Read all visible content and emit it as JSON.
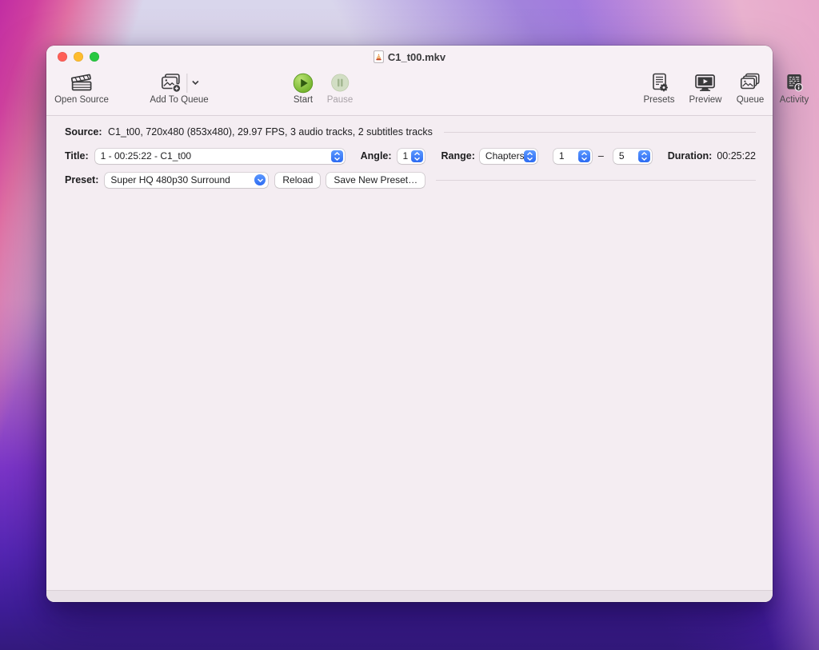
{
  "colors": {
    "accent_blue": "#2d6bf2",
    "accent_blue_light": "#5b98ff",
    "traffic_red": "#ff5f57",
    "traffic_yellow": "#febc2e",
    "traffic_green": "#28c840",
    "start_green": "#6aad24",
    "icon_gray": "#3a3a3c"
  },
  "window": {
    "title": "C1_t00.mkv"
  },
  "toolbar": {
    "open_source": "Open Source",
    "add_to_queue": "Add To Queue",
    "start": "Start",
    "pause": "Pause",
    "presets": "Presets",
    "preview": "Preview",
    "queue": "Queue",
    "activity": "Activity"
  },
  "source": {
    "label": "Source:",
    "value": "C1_t00, 720x480 (853x480), 29.97 FPS, 3 audio tracks, 2 subtitles tracks"
  },
  "title_row": {
    "label": "Title:",
    "value": "1 - 00:25:22 - C1_t00",
    "angle_label": "Angle:",
    "angle_value": "1",
    "range_label": "Range:",
    "range_type": "Chapters",
    "chapter_from": "1",
    "range_dash": "–",
    "chapter_to": "5",
    "duration_label": "Duration:",
    "duration_value": "00:25:22"
  },
  "preset": {
    "label": "Preset:",
    "value": "Super HQ 480p30 Surround",
    "reload": "Reload",
    "save_new": "Save New Preset…"
  }
}
